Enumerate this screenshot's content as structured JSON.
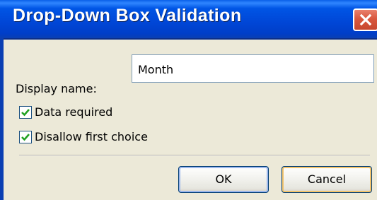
{
  "dialog": {
    "title": "Drop-Down Box Validation",
    "close_icon": "close-icon"
  },
  "form": {
    "display_name_label": "Display name:",
    "display_name_value": "Month",
    "data_required": {
      "label": "Data required",
      "checked": true
    },
    "disallow_first_choice": {
      "label": "Disallow first choice",
      "checked": true
    }
  },
  "buttons": {
    "ok_label": "OK",
    "cancel_label": "Cancel"
  },
  "colors": {
    "titlebar": "#0055e5",
    "close_button": "#d9573e",
    "dialog_background": "#ece9d8",
    "checkmark": "#21a121"
  }
}
